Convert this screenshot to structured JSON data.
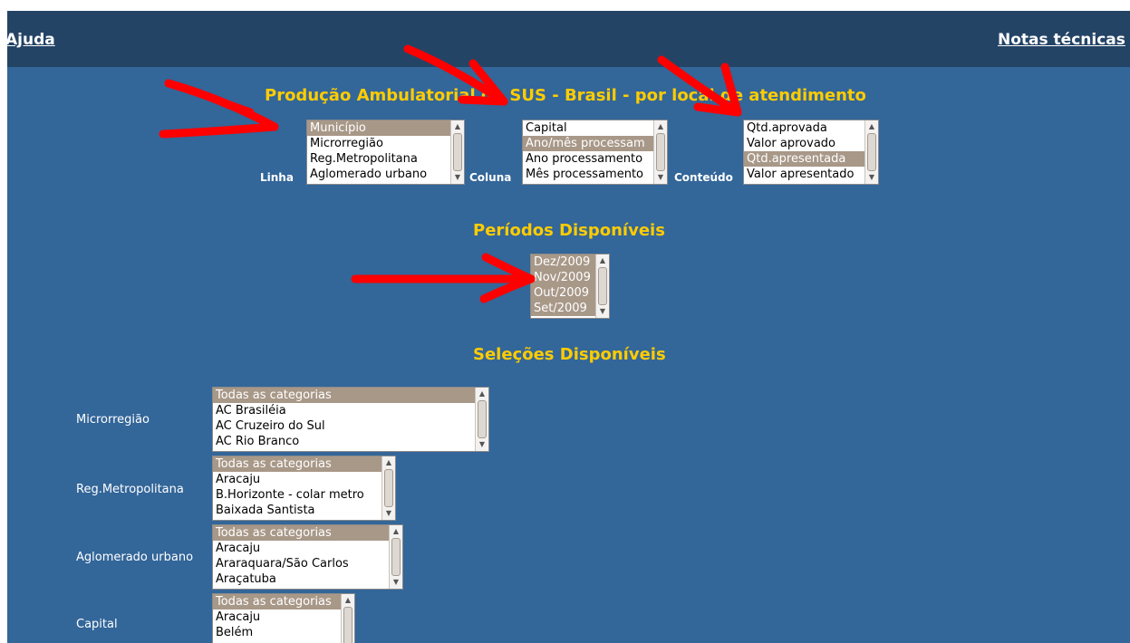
{
  "header": {
    "help_link": "Ajuda",
    "notes_link": "Notas técnicas"
  },
  "main": {
    "title": "Produção Ambulatorial do SUS - Brasil - por local de atendimento",
    "linha": {
      "label": "Linha",
      "options": [
        "Município",
        "Microrregião",
        "Reg.Metropolitana",
        "Aglomerado urbano"
      ],
      "selected": "Município"
    },
    "coluna": {
      "label": "Coluna",
      "options": [
        "Capital",
        "Ano/mês processam",
        "Ano processamento",
        "Mês processamento"
      ],
      "selected": "Ano/mês processam"
    },
    "conteudo": {
      "label": "Conteúdo",
      "options": [
        "Qtd.aprovada",
        "Valor aprovado",
        "Qtd.apresentada",
        "Valor apresentado"
      ],
      "selected": "Qtd.apresentada"
    }
  },
  "periodos": {
    "title": "Períodos Disponíveis",
    "options": [
      "Dez/2009",
      "Nov/2009",
      "Out/2009",
      "Set/2009"
    ],
    "selected": [
      "Dez/2009",
      "Nov/2009",
      "Out/2009",
      "Set/2009"
    ]
  },
  "selecoes": {
    "title": "Seleções Disponíveis",
    "groups": [
      {
        "label": "Microrregião",
        "options": [
          "Todas as categorias",
          "AC Brasiléia",
          "AC Cruzeiro do Sul",
          "AC Rio Branco"
        ]
      },
      {
        "label": "Reg.Metropolitana",
        "options": [
          "Todas as categorias",
          "Aracaju",
          "B.Horizonte - colar metro",
          "Baixada Santista"
        ]
      },
      {
        "label": "Aglomerado urbano",
        "options": [
          "Todas as categorias",
          "Aracaju",
          "Araraquara/São Carlos",
          "Araçatuba"
        ]
      },
      {
        "label": "Capital",
        "options": [
          "Todas as categorias",
          "Aracaju",
          "Belém"
        ]
      }
    ]
  },
  "colors": {
    "page_bg": "#336699",
    "header_bg": "#244466",
    "title": "#ffcc00",
    "selected_option": "#a89888",
    "annotation_arrows": "#ff0000"
  }
}
